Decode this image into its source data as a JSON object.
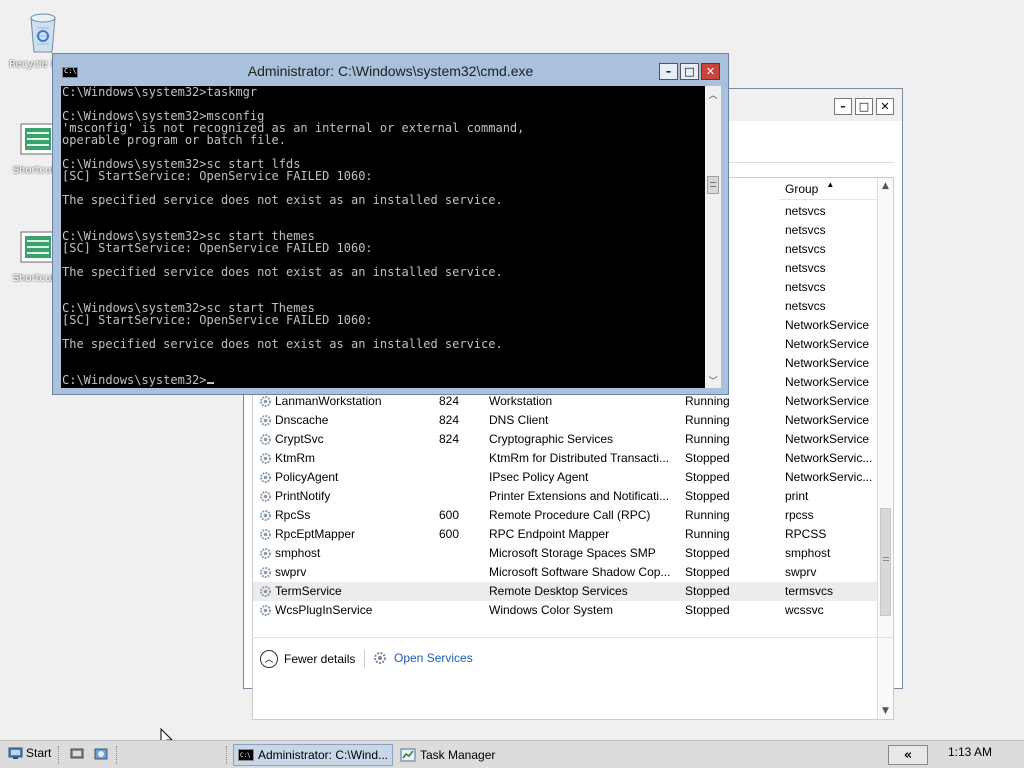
{
  "desktop": {
    "icons": [
      {
        "name": "recycle-bin",
        "label": "Recycle Bin"
      },
      {
        "name": "doc-1",
        "label": "Shortcut"
      },
      {
        "name": "doc-2",
        "label": "Shortcut"
      }
    ]
  },
  "cmd": {
    "title": "Administrator: C:\\Windows\\system32\\cmd.exe",
    "lines": [
      "C:\\Windows\\system32>taskmgr",
      "",
      "C:\\Windows\\system32>msconfig",
      "'msconfig' is not recognized as an internal or external command,",
      "operable program or batch file.",
      "",
      "C:\\Windows\\system32>sc start lfds",
      "[SC] StartService: OpenService FAILED 1060:",
      "",
      "The specified service does not exist as an installed service.",
      "",
      "",
      "C:\\Windows\\system32>sc start themes",
      "[SC] StartService: OpenService FAILED 1060:",
      "",
      "The specified service does not exist as an installed service.",
      "",
      "",
      "C:\\Windows\\system32>sc start Themes",
      "[SC] StartService: OpenService FAILED 1060:",
      "",
      "The specified service does not exist as an installed service.",
      "",
      "",
      "C:\\Windows\\system32>"
    ]
  },
  "taskmanager": {
    "group_header": "Group",
    "group_values_top": [
      "netsvcs",
      "netsvcs",
      "netsvcs",
      "netsvcs",
      "netsvcs",
      "netsvcs",
      "NetworkService",
      "NetworkService",
      "NetworkService",
      "NetworkService"
    ],
    "rows": [
      {
        "name": "LanmanWorkstation",
        "pid": "824",
        "desc": "Workstation",
        "status": "Running",
        "group": "NetworkService"
      },
      {
        "name": "Dnscache",
        "pid": "824",
        "desc": "DNS Client",
        "status": "Running",
        "group": "NetworkService"
      },
      {
        "name": "CryptSvc",
        "pid": "824",
        "desc": "Cryptographic Services",
        "status": "Running",
        "group": "NetworkService"
      },
      {
        "name": "KtmRm",
        "pid": "",
        "desc": "KtmRm for Distributed Transacti...",
        "status": "Stopped",
        "group": "NetworkServic..."
      },
      {
        "name": "PolicyAgent",
        "pid": "",
        "desc": "IPsec Policy Agent",
        "status": "Stopped",
        "group": "NetworkServic..."
      },
      {
        "name": "PrintNotify",
        "pid": "",
        "desc": "Printer Extensions and Notificati...",
        "status": "Stopped",
        "group": "print"
      },
      {
        "name": "RpcSs",
        "pid": "600",
        "desc": "Remote Procedure Call (RPC)",
        "status": "Running",
        "group": "rpcss"
      },
      {
        "name": "RpcEptMapper",
        "pid": "600",
        "desc": "RPC Endpoint Mapper",
        "status": "Running",
        "group": "RPCSS"
      },
      {
        "name": "smphost",
        "pid": "",
        "desc": "Microsoft Storage Spaces SMP",
        "status": "Stopped",
        "group": "smphost"
      },
      {
        "name": "swprv",
        "pid": "",
        "desc": "Microsoft Software Shadow Cop...",
        "status": "Stopped",
        "group": "swprv"
      },
      {
        "name": "TermService",
        "pid": "",
        "desc": "Remote Desktop Services",
        "status": "Stopped",
        "group": "termsvcs"
      },
      {
        "name": "WcsPlugInService",
        "pid": "",
        "desc": "Windows Color System",
        "status": "Stopped",
        "group": "wcssvc"
      }
    ],
    "selected_row": "TermService",
    "footer": {
      "fewer_details": "Fewer details",
      "open_services": "Open Services"
    }
  },
  "taskbar": {
    "start_label": "Start",
    "tasks": [
      {
        "label": "Administrator: C:\\Wind...",
        "icon": "cmd-icon",
        "active": true
      },
      {
        "label": "Task Manager",
        "icon": "taskmgr-icon",
        "active": false
      }
    ],
    "tray_chevron": "«",
    "clock": "1:13 AM"
  },
  "colors": {
    "cmd_frame": "#a9c1dc",
    "console_bg": "#000000",
    "console_text": "#c0c0c0",
    "close_button": "#c7463b",
    "link": "#1a5fb4"
  }
}
